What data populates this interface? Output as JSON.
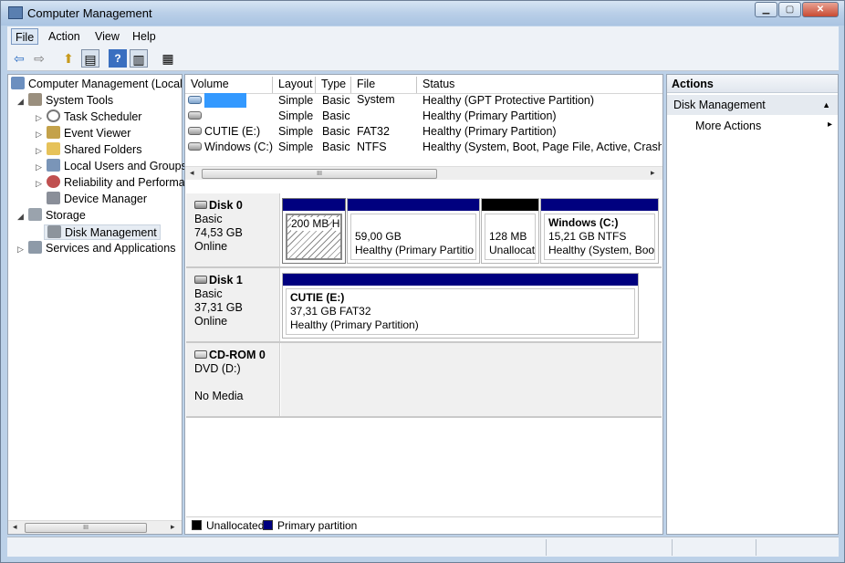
{
  "window": {
    "title": "Computer Management",
    "min_glyph": "▁",
    "max_glyph": "▢",
    "close_glyph": "✕"
  },
  "menubar": [
    {
      "label": "File",
      "selected": true
    },
    {
      "label": "Action"
    },
    {
      "label": "View"
    },
    {
      "label": "Help"
    }
  ],
  "toolbar": {
    "icons": [
      "back-icon",
      "forward-icon",
      "up-folder-icon",
      "show-hide-tree-icon",
      "help-icon",
      "show-hide-action-pane-icon",
      "properties-icon"
    ],
    "glyphs": {
      "back": "⇦",
      "forward": "⇨",
      "up": "⬆",
      "tree": "▤",
      "help": "?",
      "action_pane": "▥",
      "props": "▦"
    }
  },
  "tree": {
    "root": "Computer Management (Local",
    "items": [
      {
        "label": "System Tools",
        "icon": "tools-icon"
      },
      {
        "label": "Task Scheduler",
        "icon": "clock-icon"
      },
      {
        "label": "Event Viewer",
        "icon": "event-viewer-icon"
      },
      {
        "label": "Shared Folders",
        "icon": "shared-folder-icon"
      },
      {
        "label": "Local Users and Groups",
        "icon": "users-icon"
      },
      {
        "label": "Reliability and Performa",
        "icon": "performance-icon"
      },
      {
        "label": "Device Manager",
        "icon": "device-manager-icon"
      },
      {
        "label": "Storage",
        "icon": "storage-icon"
      },
      {
        "label": "Disk Management",
        "icon": "disk-management-icon",
        "selected": true
      },
      {
        "label": "Services and Applications",
        "icon": "services-icon"
      }
    ],
    "expand_open": "◢",
    "expand_closed": "▷",
    "scroll_left": "◂",
    "scroll_right": "▸",
    "scroll_thumb": "III"
  },
  "volume_list": {
    "columns": [
      "Volume",
      "Layout",
      "Type",
      "File System",
      "Status"
    ],
    "rows": [
      {
        "volume": "",
        "layout": "Simple",
        "type": "Basic",
        "fs": "",
        "status": "Healthy (GPT Protective Partition)",
        "highlight": true
      },
      {
        "volume": "",
        "layout": "Simple",
        "type": "Basic",
        "fs": "",
        "status": "Healthy (Primary Partition)"
      },
      {
        "volume": "CUTIE (E:)",
        "layout": "Simple",
        "type": "Basic",
        "fs": "FAT32",
        "status": "Healthy (Primary Partition)"
      },
      {
        "volume": "Windows (C:)",
        "layout": "Simple",
        "type": "Basic",
        "fs": "NTFS",
        "status": "Healthy (System, Boot, Page File, Active, Crash Du"
      }
    ],
    "scroll_thumb": "III",
    "scroll_left": "◂",
    "scroll_right": "▸"
  },
  "disks": [
    {
      "name": "Disk 0",
      "kind": "Basic",
      "size": "74,53 GB",
      "status": "Online",
      "partitions": [
        {
          "line1": "200 MB",
          "line2": "Healthy (G",
          "bar": "primary",
          "selected": true
        },
        {
          "line1": "59,00 GB",
          "line2": "Healthy (Primary Partitio",
          "bar": "primary"
        },
        {
          "line1": "128 MB",
          "line2": "Unallocat",
          "bar": "unallocated"
        },
        {
          "title": "Windows  (C:)",
          "line1": "15,21 GB NTFS",
          "line2": "Healthy (System, Boot",
          "bar": "primary"
        }
      ]
    },
    {
      "name": "Disk 1",
      "kind": "Basic",
      "size": "37,31 GB",
      "status": "Online",
      "partitions": [
        {
          "title": "CUTIE  (E:)",
          "line1": "37,31 GB FAT32",
          "line2": "Healthy (Primary Partition)",
          "bar": "primary"
        }
      ]
    },
    {
      "name": "CD-ROM 0",
      "kind": "DVD (D:)",
      "size": "",
      "status": "No Media",
      "partitions": []
    }
  ],
  "legend": [
    {
      "label": "Unallocated",
      "color": "#000000"
    },
    {
      "label": "Primary partition",
      "color": "#00007f"
    }
  ],
  "colors": {
    "primary_bar": "#00007f",
    "unallocated_bar": "#000000",
    "highlight": "#3399ff"
  },
  "actions": {
    "header": "Actions",
    "section": "Disk Management",
    "section_arrow": "▲",
    "item": "More Actions",
    "item_arrow": "▸"
  }
}
